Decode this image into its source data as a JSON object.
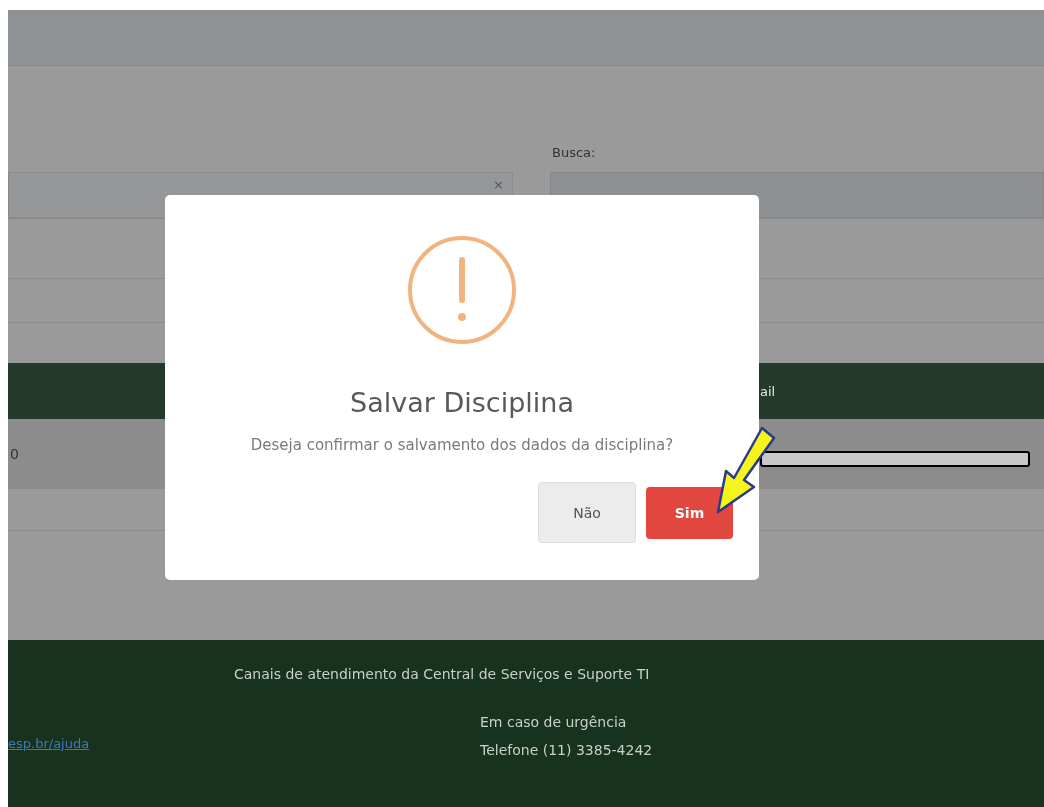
{
  "background": {
    "search_label": "Busca:",
    "clear_symbol": "×",
    "table_header_fragment": "ail",
    "row_fragment": "0"
  },
  "dialog": {
    "title": "Salvar Disciplina",
    "message": "Deseja confirmar o salvamento dos dados da disciplina?",
    "buttons": [
      {
        "label": "Não",
        "kind": "cancel"
      },
      {
        "label": "Sim",
        "kind": "confirm"
      }
    ]
  },
  "footer": {
    "heading": "Canais de atendimento da Central de Serviços e Suporte TI",
    "link": "esp.br/ajuda",
    "urgency_title": "Em caso de urgência",
    "phone": "Telefone (11) 3385-4242"
  }
}
